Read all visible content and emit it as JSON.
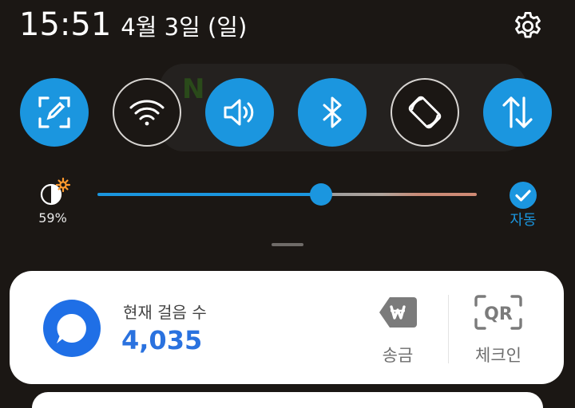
{
  "status_bar": {
    "time": "15:51",
    "date": "4월 3일 (일)"
  },
  "background_app": {
    "partial_letter": "N"
  },
  "quick_settings": [
    {
      "id": "screen-capture",
      "icon": "screen-capture-edit-icon",
      "active": true
    },
    {
      "id": "wifi",
      "icon": "wifi-icon",
      "active": false
    },
    {
      "id": "sound",
      "icon": "volume-icon",
      "active": true
    },
    {
      "id": "bluetooth",
      "icon": "bluetooth-icon",
      "active": true
    },
    {
      "id": "auto-rotate",
      "icon": "rotate-icon",
      "active": false
    },
    {
      "id": "mobile-data",
      "icon": "data-arrows-icon",
      "active": true
    }
  ],
  "brightness": {
    "percent_label": "59%",
    "level": 0.59,
    "auto_label": "자동",
    "auto_enabled": true
  },
  "step_card": {
    "label": "현재 걸음 수",
    "value": "4,035",
    "send_label": "송금",
    "send_icon": "won-tag-icon",
    "checkin_label": "체크인",
    "checkin_icon_text": "QR"
  },
  "colors": {
    "accent": "#1b96df",
    "steps_value": "#2a72df",
    "shade_bg": "#1b1714"
  }
}
